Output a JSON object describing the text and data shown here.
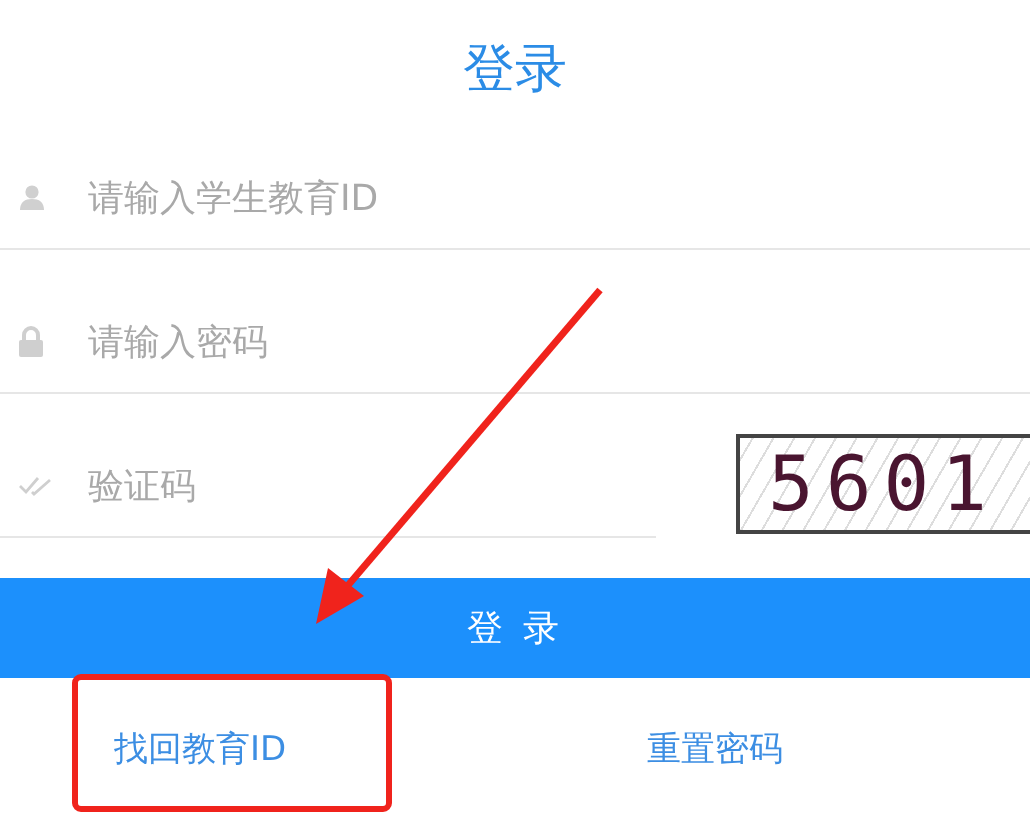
{
  "title": "登录",
  "fields": [
    {
      "kind": "user",
      "placeholder": "请输入学生教育ID"
    },
    {
      "kind": "lock",
      "placeholder": "请输入密码"
    },
    {
      "kind": "check",
      "placeholder": "验证码"
    }
  ],
  "captcha": {
    "code": "5601"
  },
  "submit_button": "登 录",
  "links": [
    "找回教育ID",
    "重置密码"
  ],
  "annotations": {
    "arrow": true,
    "highlight_frame": true
  }
}
